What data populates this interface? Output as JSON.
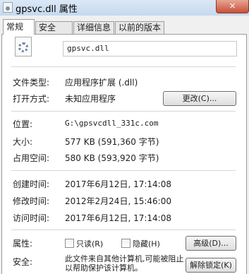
{
  "window": {
    "title": "gpsvc.dll 属性",
    "close_glyph": "×"
  },
  "tabs": [
    {
      "label": "常规"
    },
    {
      "label": "安全"
    },
    {
      "label": "详细信息"
    },
    {
      "label": "以前的版本"
    }
  ],
  "general": {
    "file_name": "gpsvc.dll",
    "file_type_label": "文件类型:",
    "file_type_value": "应用程序扩展 (.dll)",
    "opens_with_label": "打开方式:",
    "opens_with_value": "未知应用程序",
    "change_button": "更改(C)...",
    "location_label": "位置:",
    "location_value": "G:\\gpsvcdll_331c.com",
    "size_label": "大小:",
    "size_value": "577 KB (591,360 字节)",
    "size_on_disk_label": "占用空间:",
    "size_on_disk_value": "580 KB (593,920 字节)",
    "created_label": "创建时间:",
    "created_value": "2017年6月12日, 17:14:08",
    "modified_label": "修改时间:",
    "modified_value": "2012年2月24日, 15:46:00",
    "accessed_label": "访问时间:",
    "accessed_value": "2017年6月12日, 17:14:08",
    "attributes_label": "属性:",
    "readonly_label": "只读(R)",
    "hidden_label": "隐藏(H)",
    "advanced_button": "高级(D)...",
    "security_label": "安全:",
    "security_text": "此文件来自其他计算机,可能被阻止以帮助保护该计算机。",
    "unblock_button": "解除锁定(K)"
  },
  "colors": {
    "titlebar": "#cfe0f2",
    "close_button": "#c7503a",
    "panel": "#ffffff"
  }
}
